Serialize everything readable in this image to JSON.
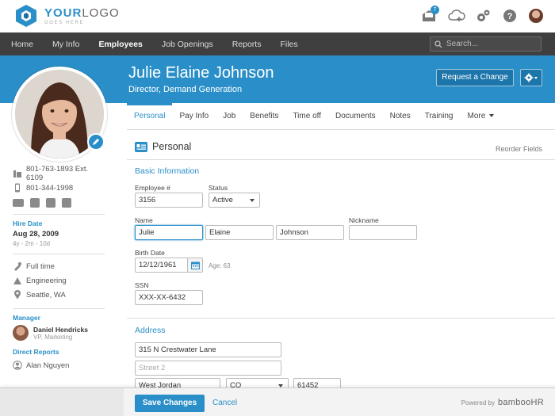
{
  "logo": {
    "main_bold": "YOUR",
    "main_rest": "LOGO",
    "sub": "GOES HERE"
  },
  "topbar": {
    "inbox_count": "7"
  },
  "nav": {
    "items": [
      "Home",
      "My Info",
      "Employees",
      "Job Openings",
      "Reports",
      "Files"
    ],
    "active": "Employees",
    "search_placeholder": "Search..."
  },
  "employee": {
    "name": "Julie Elaine Johnson",
    "title": "Director, Demand Generation",
    "request_change_label": "Request a Change"
  },
  "sidebar": {
    "work_phone": "801-763-1893  Ext. 6109",
    "mobile_phone": "801-344-1998",
    "hire_date_label": "Hire Date",
    "hire_date": "Aug 28, 2009",
    "tenure": "4y - 2m - 10d",
    "employment_type": "Full time",
    "department": "Engineering",
    "location": "Seattle, WA",
    "manager_label": "Manager",
    "manager_name": "Daniel Hendricks",
    "manager_title": "VP, Marketing",
    "direct_reports_label": "Direct Reports",
    "direct_report_1": "Alan Nguyen"
  },
  "tabs": [
    "Personal",
    "Pay Info",
    "Job",
    "Benefits",
    "Time off",
    "Documents",
    "Notes",
    "Training",
    "More"
  ],
  "active_tab": "Personal",
  "section": {
    "title": "Personal",
    "reorder": "Reorder Fields",
    "basic_info": "Basic Information",
    "address": "Address"
  },
  "form": {
    "employee_no_label": "Employee #",
    "employee_no": "3156",
    "status_label": "Status",
    "status": "Active",
    "name_label": "Name",
    "first_name": "Julie",
    "middle_name": "Elaine",
    "last_name": "Johnson",
    "nickname_label": "Nickname",
    "nickname": "",
    "birth_date_label": "Birth Date",
    "birth_date": "12/12/1961",
    "age": "Age: 63",
    "ssn_label": "SSN",
    "ssn": "XXX-XX-6432",
    "street1": "315 N Crestwater Lane",
    "street2_placeholder": "Street 2",
    "city": "West Jordan",
    "state": "CO",
    "zip": "61452"
  },
  "footer": {
    "save_label": "Save Changes",
    "cancel_label": "Cancel",
    "powered_by": "Powered by",
    "brand": "bambooHR"
  },
  "colors": {
    "accent": "#2a8fc9",
    "nav_bg": "#3f3f3f"
  }
}
